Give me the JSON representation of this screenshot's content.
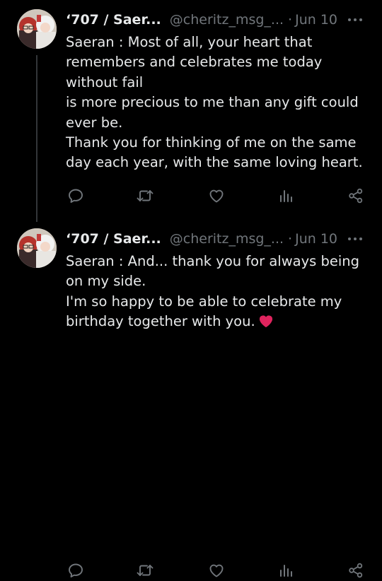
{
  "thread": {
    "tweets": [
      {
        "display_name": "‘707 / Saer...",
        "handle": "@cheritz_msg_...",
        "separator": "·",
        "date": "Jun 10",
        "lines": [
          "Saeran : Most of all, your heart that",
          "remembers and celebrates me today",
          "without fail",
          "is more precious to me than any gift could",
          "ever be.",
          "Thank you for thinking of me on the same",
          "day each year, with the same loving heart."
        ]
      },
      {
        "display_name": "‘707 / Saer...",
        "handle": "@cheritz_msg_...",
        "separator": "·",
        "date": "Jun 10",
        "lines": [
          "Saeran : And... thank you for always being",
          "on my side.",
          "I'm so happy to be able to celebrate my",
          "birthday together with you."
        ],
        "emoji": "red-heart"
      }
    ]
  },
  "icons": {
    "more": "more-dots-icon",
    "reply": "reply-icon",
    "retweet": "retweet-icon",
    "like": "like-heart-icon",
    "views": "views-icon",
    "share": "share-icon"
  },
  "colors": {
    "background": "#000000",
    "text": "#e7e9ea",
    "secondary": "#71767b",
    "thread_line": "#333639",
    "heart": "#e0245e"
  }
}
